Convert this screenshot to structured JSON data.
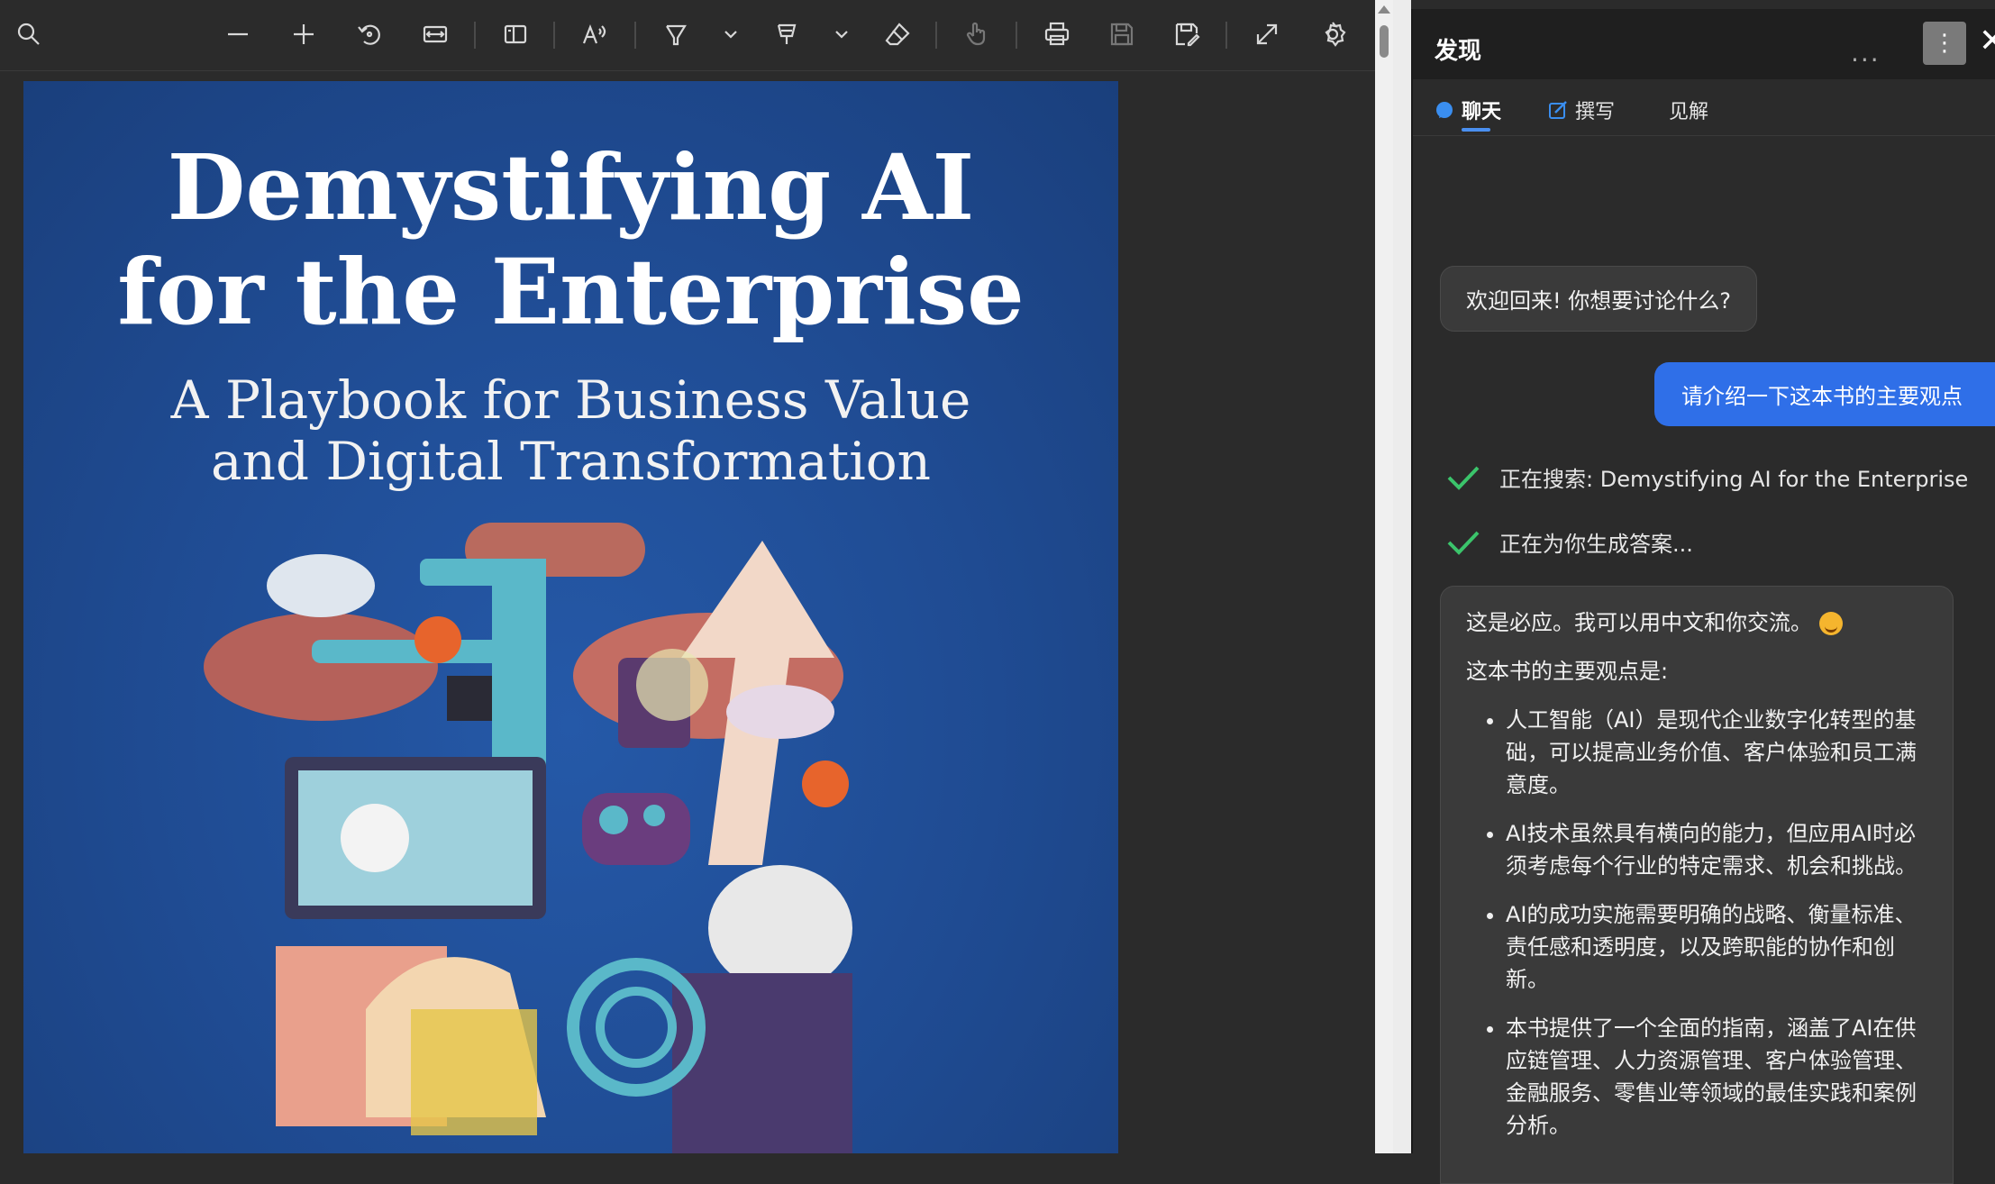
{
  "viewer": {
    "toolbar": [
      "search-icon",
      "zoom-out-icon",
      "zoom-in-icon",
      "rotate-icon",
      "fit-width-icon",
      "page-view-icon",
      "read-aloud-icon",
      "highlight-icon",
      "draw-icon",
      "erase-icon",
      "touch-icon",
      "print-icon",
      "save-icon",
      "save-as-icon",
      "fullscreen-icon",
      "settings-icon"
    ],
    "cover": {
      "title_line1": "Demystifying AI",
      "title_line2": "for the Enterprise",
      "subtitle_line1": "A Playbook for Business Value",
      "subtitle_line2": "and Digital Transformation"
    }
  },
  "panel": {
    "title": "发现",
    "more": "···",
    "tabs": [
      {
        "label": "聊天",
        "icon": "chat-icon",
        "active": true
      },
      {
        "label": "撰写",
        "icon": "compose-icon",
        "active": false
      },
      {
        "label": "见解",
        "icon": "",
        "active": false
      }
    ],
    "welcome": "欢迎回来! 你想要讨论什么?",
    "user_message": "请介绍一下这本书的主要观点",
    "status": [
      "正在搜索: Demystifying AI for the Enterprise",
      "正在为你生成答案..."
    ],
    "answer": {
      "intro": "这是必应。我可以用中文和你交流。",
      "lead": "这本书的主要观点是:",
      "bullets": [
        "人工智能（AI）是现代企业数字化转型的基础，可以提高业务价值、客户体验和员工满意度。",
        "AI技术虽然具有横向的能力，但应用AI时必须考虑每个行业的特定需求、机会和挑战。",
        "AI的成功实施需要明确的战略、衡量标准、责任感和透明度，以及跨职能的协作和创新。",
        "本书提供了一个全面的指南，涵盖了AI在供应链管理、人力资源管理、客户体验管理、金融服务、零售业等领域的最佳实践和案例分析。"
      ]
    }
  }
}
